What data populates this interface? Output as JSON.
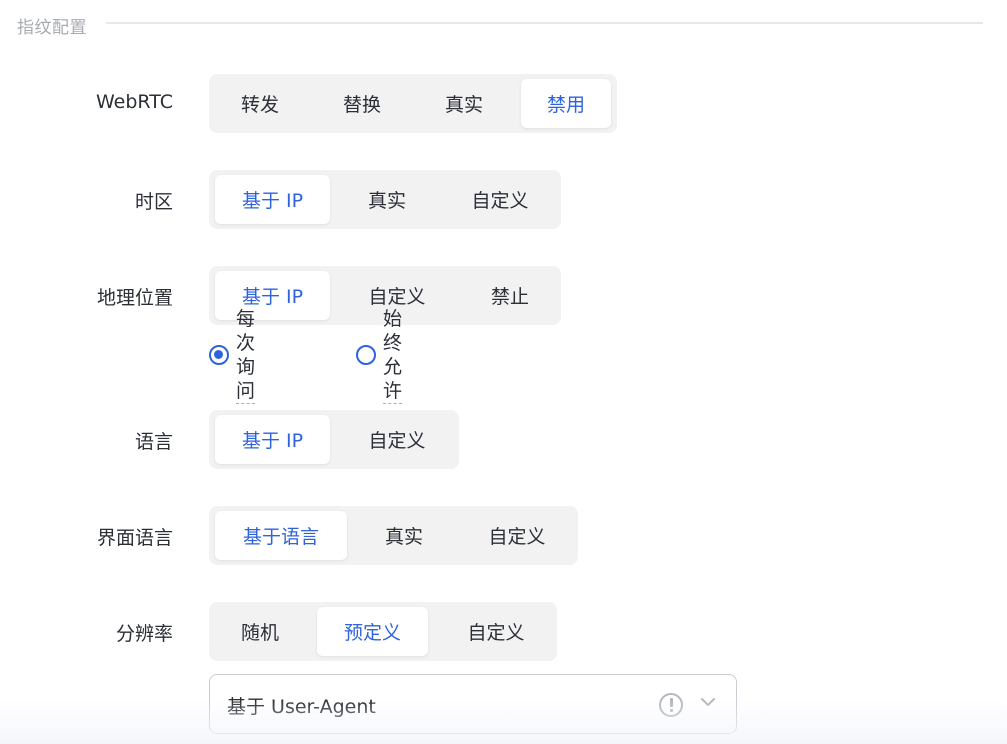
{
  "section": {
    "title": "指纹配置"
  },
  "webrtc": {
    "label": "WebRTC",
    "options": [
      "转发",
      "替换",
      "真实",
      "禁用"
    ]
  },
  "timezone": {
    "label": "时区",
    "options": [
      "基于 IP",
      "真实",
      "自定义"
    ]
  },
  "geo": {
    "label": "地理位置",
    "options": [
      "基于 IP",
      "自定义",
      "禁止"
    ],
    "radios": [
      {
        "label": "每次询问",
        "checked": true
      },
      {
        "label": "始终允许",
        "checked": false
      }
    ]
  },
  "language": {
    "label": "语言",
    "options": [
      "基于 IP",
      "自定义"
    ]
  },
  "ui_language": {
    "label": "界面语言",
    "options": [
      "基于语言",
      "真实",
      "自定义"
    ]
  },
  "resolution": {
    "label": "分辨率",
    "options": [
      "随机",
      "预定义",
      "自定义"
    ],
    "select_value": "基于 User-Agent"
  },
  "colors": {
    "accent": "#2f63de",
    "segment_bg": "#f2f2f3",
    "text": "#2b2f36",
    "muted": "#a7abb2"
  },
  "icons": {
    "select_info": "info-circle-icon",
    "select_chevron": "chevron-down-icon"
  }
}
